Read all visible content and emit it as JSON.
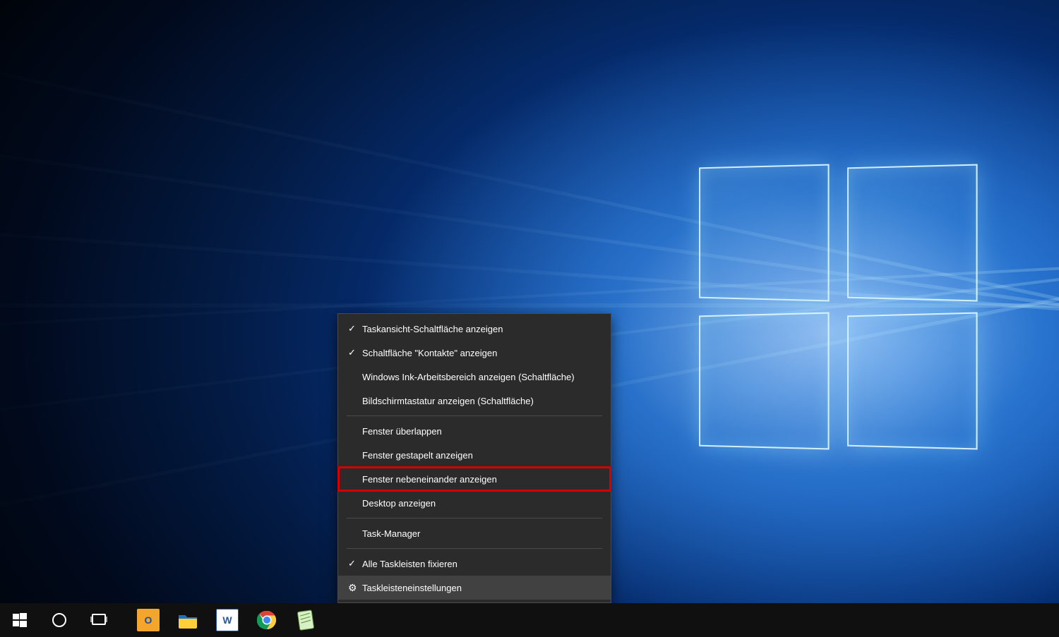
{
  "context_menu": {
    "items": [
      {
        "label": "Taskansicht-Schaltfläche anzeigen",
        "checked": true
      },
      {
        "label": "Schaltfläche \"Kontakte\" anzeigen",
        "checked": true
      },
      {
        "label": "Windows Ink-Arbeitsbereich anzeigen (Schaltfläche)",
        "checked": false
      },
      {
        "label": "Bildschirmtastatur anzeigen (Schaltfläche)",
        "checked": false
      }
    ],
    "window_items": [
      {
        "label": "Fenster überlappen"
      },
      {
        "label": "Fenster gestapelt anzeigen"
      },
      {
        "label": "Fenster nebeneinander anzeigen",
        "highlighted": true
      },
      {
        "label": "Desktop anzeigen"
      }
    ],
    "taskmgr_label": "Task-Manager",
    "lock_item": {
      "label": "Alle Taskleisten fixieren",
      "checked": true
    },
    "settings_label": "Taskleisteneinstellungen"
  },
  "taskbar": {
    "start": "Start",
    "cortana": "Cortana",
    "taskview": "Task View",
    "pinned": [
      {
        "name": "outlook",
        "bg": "#f3a62b",
        "fg": "#1e4ea0",
        "glyph": "O"
      },
      {
        "name": "file-explorer",
        "bg": "#ffcf3a",
        "fg": "#1c6dd0",
        "glyph": ""
      },
      {
        "name": "word",
        "bg": "#ffffff",
        "fg": "#2b579a",
        "glyph": "W"
      },
      {
        "name": "chrome",
        "bg": "",
        "fg": "",
        "glyph": ""
      },
      {
        "name": "notepadpp",
        "bg": "#9fd563",
        "fg": "#33691e",
        "glyph": ""
      }
    ]
  }
}
